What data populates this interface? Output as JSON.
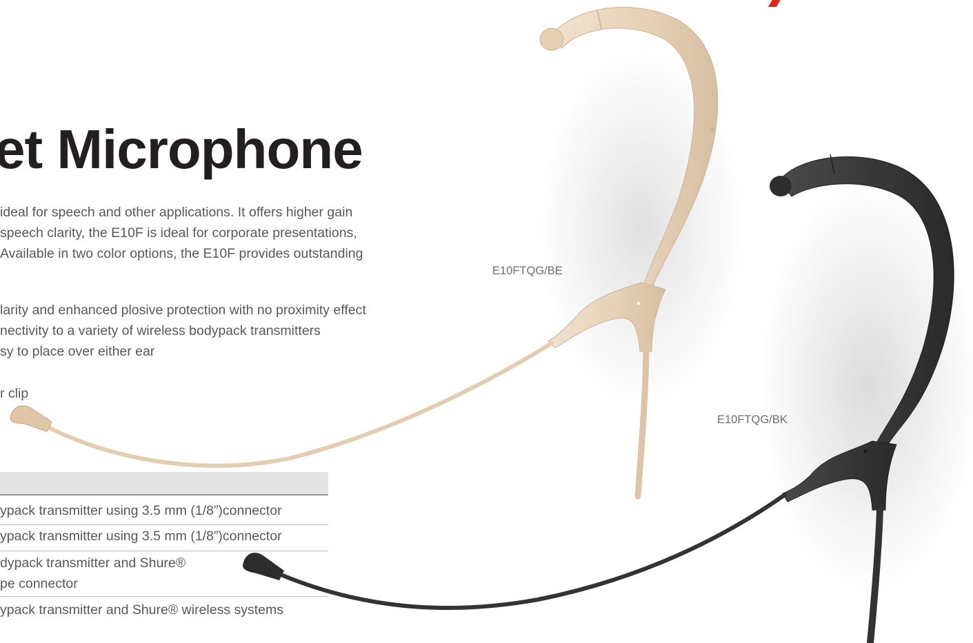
{
  "heading": {
    "title": "et Microphone"
  },
  "description": {
    "lines": [
      "ideal for speech and other applications. It offers higher gain",
      "speech clarity, the E10F is ideal for corporate presentations,",
      "Available in two color options, the E10F provides outstanding"
    ]
  },
  "features": {
    "lines": [
      "larity and enhanced plosive protection with no proximity effect",
      "nectivity to a variety of wireless bodypack transmitters",
      "sy to place over either ear"
    ],
    "ear_clip": "r clip"
  },
  "product_captions": {
    "beige": "E10FTQG/BE",
    "black": "E10FTQG/BK"
  },
  "table": {
    "rows": [
      {
        "lines": [
          "ypack transmitter using 3.5 mm (1/8”)connector"
        ]
      },
      {
        "lines": [
          "ypack transmitter using 3.5 mm (1/8”)connector"
        ]
      },
      {
        "lines": [
          "dypack transmitter and Shure®",
          "pe connector"
        ]
      },
      {
        "lines": [
          "ypack transmitter and Shure® wireless systems"
        ]
      }
    ]
  },
  "colors": {
    "brand_accent": "#e1251b",
    "beige_mic": "#e9d6bf",
    "black_mic": "#3b3b3b",
    "table_header": "#e4e4e4"
  }
}
